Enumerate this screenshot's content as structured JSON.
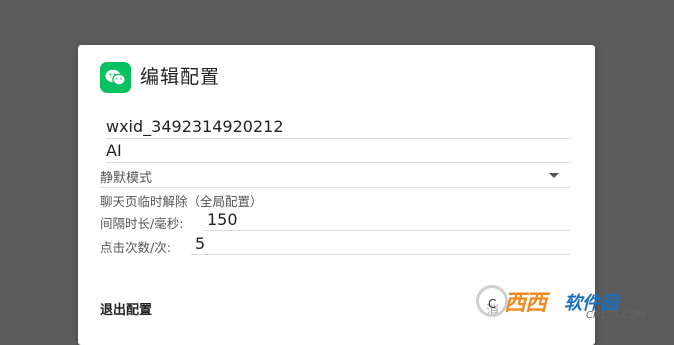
{
  "dialog": {
    "title": "编辑配置",
    "app_icon": "wechat-icon",
    "fields": {
      "wxid": "wxid_3492314920212",
      "name": "AI",
      "mode": "静默模式"
    },
    "section_label": "聊天页临时解除（全局配置）",
    "interval_label": "间隔时长/毫秒:",
    "interval_value": "150",
    "clicks_label": "点击次数/次:",
    "clicks_value": "5",
    "exit_label": "退出配置",
    "cancel_label": "消"
  },
  "watermark": {
    "brand": "西西",
    "name": "软件园",
    "domain": "CR173.COM",
    "ring_text": "C"
  },
  "colors": {
    "backdrop": "#5c5c5c",
    "wechat_green": "#07c160",
    "watermark_orange": "#f08a1c",
    "watermark_blue": "#1a6fbf"
  }
}
